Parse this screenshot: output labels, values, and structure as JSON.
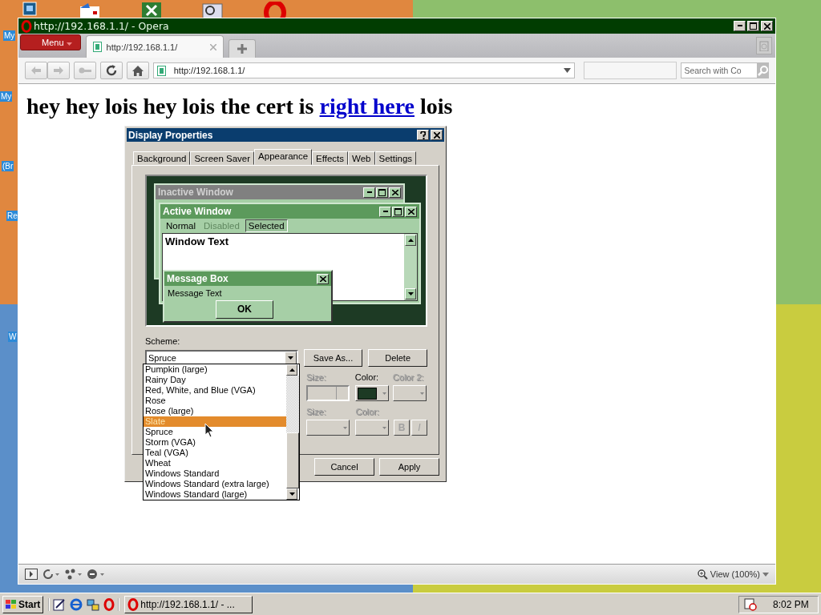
{
  "desktop": {
    "icon_labels": [
      "My",
      "My",
      "(Br",
      "Re",
      "W"
    ]
  },
  "browser": {
    "title": "http://192.168.1.1/ - Opera",
    "menu_button": "Menu",
    "tabs": [
      {
        "label": "http://192.168.1.1/",
        "selected": true
      }
    ],
    "address": "http://192.168.1.1/",
    "search_placeholder": "Search with Co",
    "heading": {
      "before": "hey hey lois hey lois the cert is",
      "link": "right here",
      "after": "lois"
    },
    "status_bar": {
      "zoom": "View (100%)"
    }
  },
  "dialog": {
    "title": "Display Properties",
    "tabs": [
      {
        "label": "Background",
        "selected": false
      },
      {
        "label": "Screen Saver",
        "selected": false
      },
      {
        "label": "Appearance",
        "selected": true
      },
      {
        "label": "Effects",
        "selected": false
      },
      {
        "label": "Web",
        "selected": false
      },
      {
        "label": "Settings",
        "selected": false
      }
    ],
    "preview": {
      "inactive_title": "Inactive Window",
      "active_title": "Active Window",
      "menu_items": [
        {
          "label": "Normal",
          "kind": "normal"
        },
        {
          "label": "Disabled",
          "kind": "disabled"
        },
        {
          "label": "Selected",
          "kind": "selected"
        }
      ],
      "window_text": "Window Text",
      "message_title": "Message Box",
      "message_text": "Message Text",
      "ok": "OK"
    },
    "scheme_label": "Scheme:",
    "scheme_value": "Spruce",
    "save_as": "Save As...",
    "delete": "Delete",
    "item_fields": [
      {
        "label": "Size:",
        "disabled": true
      },
      {
        "label": "Color:",
        "disabled": false
      },
      {
        "label": "Color 2:",
        "disabled": true
      }
    ],
    "font_fields": [
      {
        "label": "Size:",
        "disabled": true
      },
      {
        "label": "Color:",
        "disabled": true
      }
    ],
    "font_styles": [
      {
        "label": "B",
        "kind": "bold"
      },
      {
        "label": "I",
        "kind": "italic"
      }
    ],
    "buttons": [
      "Cancel",
      "Apply"
    ],
    "scheme_list": [
      {
        "label": "Pumpkin (large)",
        "selected": false
      },
      {
        "label": "Rainy Day",
        "selected": false
      },
      {
        "label": "Red, White, and Blue (VGA)",
        "selected": false
      },
      {
        "label": "Rose",
        "selected": false
      },
      {
        "label": "Rose (large)",
        "selected": false
      },
      {
        "label": "Slate",
        "selected": true
      },
      {
        "label": "Spruce",
        "selected": false
      },
      {
        "label": "Storm (VGA)",
        "selected": false
      },
      {
        "label": "Teal (VGA)",
        "selected": false
      },
      {
        "label": "Wheat",
        "selected": false
      },
      {
        "label": "Windows Standard",
        "selected": false
      },
      {
        "label": "Windows Standard (extra large)",
        "selected": false
      },
      {
        "label": "Windows Standard (large)",
        "selected": false
      }
    ]
  },
  "taskbar": {
    "start": "Start",
    "tasks": [
      {
        "label": "http://192.168.1.1/ - ...",
        "selected": false
      }
    ],
    "clock": "8:02 PM"
  }
}
